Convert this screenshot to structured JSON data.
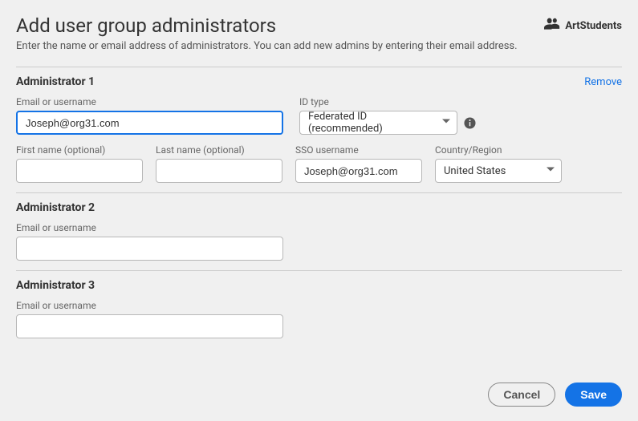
{
  "header": {
    "title": "Add user group administrators",
    "group_name": "ArtStudents"
  },
  "subtitle": "Enter the name or email address of administrators. You can add new admins by entering their email address.",
  "labels": {
    "email": "Email or username",
    "id_type": "ID type",
    "first_name": "First name (optional)",
    "last_name": "Last name (optional)",
    "sso": "SSO username",
    "region": "Country/Region"
  },
  "admins": [
    {
      "title": "Administrator 1",
      "remove": "Remove",
      "email": "Joseph@org31.com",
      "id_type_selected": "Federated ID (recommended)",
      "first_name": "",
      "last_name": "",
      "sso": "Joseph@org31.com",
      "region_selected": "United States"
    },
    {
      "title": "Administrator 2",
      "email": ""
    },
    {
      "title": "Administrator 3",
      "email": ""
    }
  ],
  "buttons": {
    "cancel": "Cancel",
    "save": "Save"
  }
}
